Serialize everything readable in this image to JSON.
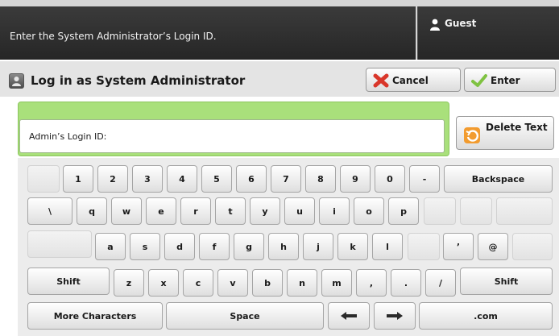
{
  "header": {
    "message": "Enter the System Administrator’s Login ID.",
    "user_name": "Guest",
    "user_icon": "user-icon"
  },
  "titlebar": {
    "title": "Log in as System Administrator",
    "title_icon": "admin-icon",
    "cancel_label": "Cancel",
    "enter_label": "Enter"
  },
  "form": {
    "field_label": "Admin’s Login ID:",
    "field_value": "",
    "delete_label": "Delete Text"
  },
  "keyboard": {
    "row1": [
      "1",
      "2",
      "3",
      "4",
      "5",
      "6",
      "7",
      "8",
      "9",
      "0",
      "-"
    ],
    "backspace": "Backspace",
    "row2": [
      "\\",
      "q",
      "w",
      "e",
      "r",
      "t",
      "y",
      "u",
      "i",
      "o",
      "p"
    ],
    "row3": [
      "a",
      "s",
      "d",
      "f",
      "g",
      "h",
      "j",
      "k",
      "l"
    ],
    "apostrophe": "’",
    "at": "@",
    "shift_left": "Shift",
    "row4": [
      "z",
      "x",
      "c",
      "v",
      "b",
      "n",
      "m",
      ",",
      ".",
      "/"
    ],
    "shift_right": "Shift",
    "more_characters": "More Characters",
    "space": "Space",
    "left_arrow": "←",
    "right_arrow": "→",
    "dotcom": ".com"
  },
  "colors": {
    "accent_green": "#a9e07b",
    "cancel_red": "#d9362a",
    "enter_green": "#7fc241",
    "delete_orange": "#f29b2e"
  }
}
